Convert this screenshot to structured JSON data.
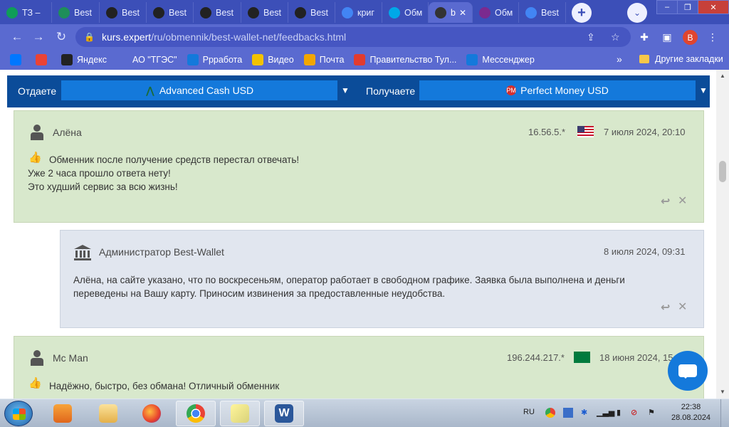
{
  "browser": {
    "tabs": [
      {
        "title": "ТЗ –",
        "icon": "sheets-icon",
        "color": "#0f9d58"
      },
      {
        "title": "Best",
        "icon": "shield-icon",
        "color": "#1e8e5a"
      },
      {
        "title": "Best",
        "icon": "p-coin-icon",
        "color": "#222"
      },
      {
        "title": "Best",
        "icon": "p-coin-icon",
        "color": "#222"
      },
      {
        "title": "Best",
        "icon": "p-coin-icon",
        "color": "#222"
      },
      {
        "title": "Best",
        "icon": "p-coin-icon",
        "color": "#222"
      },
      {
        "title": "Best",
        "icon": "p-coin-icon",
        "color": "#222"
      },
      {
        "title": "криг",
        "icon": "google-icon",
        "color": "#4285f4"
      },
      {
        "title": "Обм",
        "icon": "w-icon",
        "color": "#00a8e8"
      },
      {
        "title": "b",
        "icon": "glasses-icon",
        "color": "#333",
        "active": true
      },
      {
        "title": "Обм",
        "icon": "c-icon",
        "color": "#7b2a8f"
      },
      {
        "title": "Best",
        "icon": "docs-icon",
        "color": "#4285f4"
      }
    ],
    "url_domain": "kurs.expert",
    "url_path": "/ru/obmennik/best-wallet-net/feedbacks.html",
    "profile_letter": "B"
  },
  "bookmarks": [
    {
      "label": "",
      "icon": "vk-icon",
      "color": "#0077ff"
    },
    {
      "label": "",
      "icon": "gmail-icon",
      "color": "#ea4335"
    },
    {
      "label": "Яндекс",
      "icon": "yandex-icon",
      "color": "#222"
    },
    {
      "label": "АО \"ТГЭС\"",
      "icon": "tges-icon",
      "color": "#5a6ad0"
    },
    {
      "label": "Ррработа",
      "icon": "chat-icon",
      "color": "#1479db"
    },
    {
      "label": "Видео",
      "icon": "play-icon",
      "color": "#f2c200"
    },
    {
      "label": "Почта",
      "icon": "mail-icon",
      "color": "#f2a600"
    },
    {
      "label": "Правительство Тул...",
      "icon": "emblem-icon",
      "color": "#e23b2e"
    },
    {
      "label": "Мессенджер",
      "icon": "chat-icon",
      "color": "#1479db"
    }
  ],
  "bookmarks_more": "»",
  "bookmarks_other": "Другие закладки",
  "exchange": {
    "give_label": "Отдаете",
    "give_value": "Advanced Cash USD",
    "get_label": "Получаете",
    "get_value": "Perfect Money USD",
    "arrow": "▼"
  },
  "feedbacks": [
    {
      "author": "Алёна",
      "ip": "16.56.5.*",
      "date": "7 июля 2024, 20:10",
      "lines": [
        "Обменник после получение средств перестал отвечать!",
        "Уже 2 часа прошло ответа нету!",
        "Это худший сервис за всю жизнь!"
      ]
    },
    {
      "author": "Администратор Best-Wallet",
      "date": "8 июля 2024, 09:31",
      "lines": [
        "Алёна, на сайте указано, что по воскресеньям, оператор работает в свободном графике. Заявка была выполнена и деньги",
        "переведены на Вашу карту. Приносим извинения за предоставленные неудобства."
      ]
    },
    {
      "author": "Mc Man",
      "ip": "196.244.217.*",
      "date": "18 июня 2024, 15",
      "lines": [
        "Надёжно, быстро, без обмана! Отличный обменник"
      ]
    }
  ],
  "taskbar": {
    "lang": "RU",
    "time": "22:38",
    "date": "28.08.2024"
  }
}
